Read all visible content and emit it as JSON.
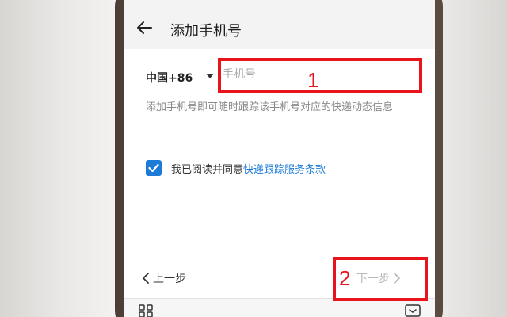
{
  "status_bar": {
    "left_text": "",
    "right_text": ""
  },
  "header": {
    "title": "添加手机号",
    "back_icon": "arrow-left-icon"
  },
  "form": {
    "country_code": "中国+86",
    "dropdown_icon": "caret-down-icon",
    "phone_input": {
      "value": "",
      "placeholder": "手机号"
    },
    "hint": "添加手机号即可随时跟踪该手机号对应的快递动态信息",
    "agreement": {
      "checked": true,
      "checkbox_icon": "checkmark-icon",
      "text": "我已阅读并同意",
      "link": "快递跟踪服务条款"
    }
  },
  "footer": {
    "prev_label": "上一步",
    "prev_icon": "chevron-left-icon",
    "next_label": "下一步",
    "next_icon": "chevron-right-icon",
    "next_enabled": false
  },
  "bottom_bar": {
    "left_icon": "apps-icon",
    "right_icon": "keyboard-icon"
  },
  "annotations": [
    {
      "label": "1",
      "target": "phone-input"
    },
    {
      "label": "2",
      "target": "next-button"
    }
  ],
  "colors": {
    "accent": "#1d7bd8",
    "annotation": "#e8141c",
    "disabled_text": "#b8b8b8"
  }
}
